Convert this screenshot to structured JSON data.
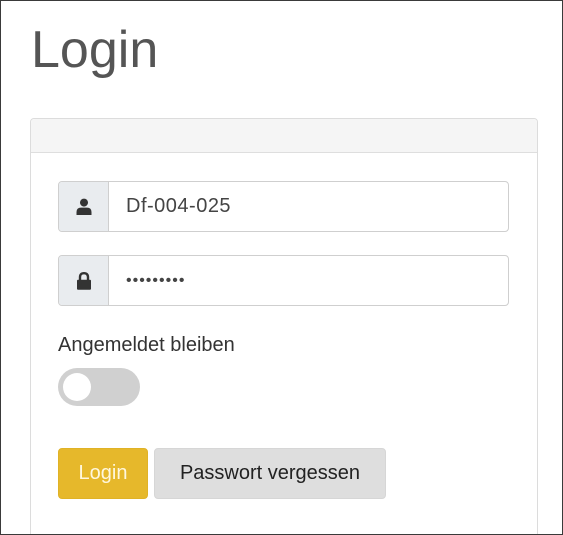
{
  "page": {
    "title": "Login"
  },
  "form": {
    "username": {
      "value": "Df-004-025",
      "icon": "user-icon"
    },
    "password": {
      "value": "•••••••••",
      "icon": "lock-icon"
    },
    "remember": {
      "label": "Angemeldet bleiben",
      "checked": false
    },
    "login_button": "Login",
    "forgot_button": "Passwort vergessen"
  },
  "colors": {
    "title": "#555555",
    "login_button_bg": "#e6b82b",
    "secondary_button_bg": "#dedede",
    "addon_bg": "#e9ecef",
    "toggle_off": "#d0d0d0"
  }
}
